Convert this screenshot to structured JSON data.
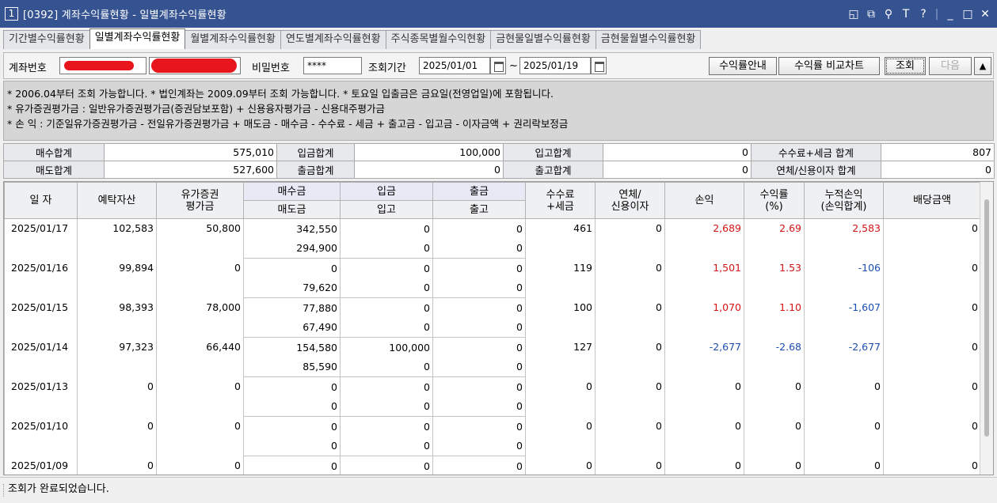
{
  "window": {
    "number": "1",
    "title": "[0392] 계좌수익률현황 - 일별계좌수익률현황",
    "controls": [
      "◱",
      "⧉",
      "⚲",
      "T",
      "?",
      "|",
      "_",
      "□",
      "✕"
    ]
  },
  "tabs": [
    "기간별수익률현황",
    "일별계좌수익률현황",
    "월별계좌수익률현황",
    "연도별계좌수익률현황",
    "주식종목별월수익현황",
    "금현물일별수익률현황",
    "금현물월별수익률현황"
  ],
  "toolbar": {
    "account_label": "계좌번호",
    "password_label": "비밀번호",
    "password_value": "****",
    "period_label": "조회기간",
    "date_from": "2025/01/01",
    "tilde": "~",
    "date_to": "2025/01/19",
    "btn_guide": "수익률안내",
    "btn_compare": "수익률 비교차트",
    "btn_search": "조회",
    "btn_next": "다음",
    "btn_collapse": "▲"
  },
  "notices": [
    "* 2006.04부터 조회 가능합니다.   * 법인계좌는 2009.09부터 조회 가능합니다.   * 토요일 입출금은 금요일(전영업일)에 포함됩니다.",
    "* 유가증권평가금 : 일반유가증권평가금(증권담보포함) + 신용융자평가금 - 신용대주평가금",
    "* 손          익 : 기준일유가증권평가금 - 전일유가증권평가금 + 매도금 - 매수금 - 수수료 - 세금 + 출고금 - 입고금 - 이자금액 + 권리락보정금"
  ],
  "summary": [
    [
      {
        "label": "매수합계",
        "value": "575,010"
      },
      {
        "label": "입금합계",
        "value": "100,000"
      },
      {
        "label": "입고합계",
        "value": "0"
      },
      {
        "label": "수수료+세금 합계",
        "value": "807"
      }
    ],
    [
      {
        "label": "매도합계",
        "value": "527,600"
      },
      {
        "label": "출금합계",
        "value": "0"
      },
      {
        "label": "출고합계",
        "value": "0"
      },
      {
        "label": "연체/신용이자 합계",
        "value": "0"
      }
    ]
  ],
  "grid": {
    "headers": {
      "date": "일 자",
      "deposit": "예탁자산",
      "securities": "유가증권\n평가금",
      "buy": "매수금",
      "sell": "매도금",
      "in_cash": "입금",
      "in_stock": "입고",
      "out_cash": "출금",
      "out_stock": "출고",
      "fee": "수수료\n+세금",
      "overdue": "연체/\n신용이자",
      "pnl": "손익",
      "rate": "수익률\n(%)",
      "cum": "누적손익\n(손익합계)",
      "dividend": "배당금액"
    },
    "rows": [
      {
        "date": "2025/01/17",
        "deposit": "102,583",
        "securities": "50,800",
        "buy": "342,550",
        "sell": "294,900",
        "in_cash": "0",
        "in_stock": "0",
        "out_cash": "0",
        "out_stock": "0",
        "fee": "461",
        "overdue": "0",
        "pnl": "2,689",
        "rate": "2.69",
        "cum": "2,583",
        "dividend": "0",
        "pnl_color": "red",
        "rate_color": "red",
        "cum_color": "red"
      },
      {
        "date": "2025/01/16",
        "deposit": "99,894",
        "securities": "0",
        "buy": "0",
        "sell": "79,620",
        "in_cash": "0",
        "in_stock": "0",
        "out_cash": "0",
        "out_stock": "0",
        "fee": "119",
        "overdue": "0",
        "pnl": "1,501",
        "rate": "1.53",
        "cum": "-106",
        "dividend": "0",
        "pnl_color": "red",
        "rate_color": "red",
        "cum_color": "blue"
      },
      {
        "date": "2025/01/15",
        "deposit": "98,393",
        "securities": "78,000",
        "buy": "77,880",
        "sell": "67,490",
        "in_cash": "0",
        "in_stock": "0",
        "out_cash": "0",
        "out_stock": "0",
        "fee": "100",
        "overdue": "0",
        "pnl": "1,070",
        "rate": "1.10",
        "cum": "-1,607",
        "dividend": "0",
        "pnl_color": "red",
        "rate_color": "red",
        "cum_color": "blue"
      },
      {
        "date": "2025/01/14",
        "deposit": "97,323",
        "securities": "66,440",
        "buy": "154,580",
        "sell": "85,590",
        "in_cash": "100,000",
        "in_stock": "0",
        "out_cash": "0",
        "out_stock": "0",
        "fee": "127",
        "overdue": "0",
        "pnl": "-2,677",
        "rate": "-2.68",
        "cum": "-2,677",
        "dividend": "0",
        "pnl_color": "blue",
        "rate_color": "blue",
        "cum_color": "blue"
      },
      {
        "date": "2025/01/13",
        "deposit": "0",
        "securities": "0",
        "buy": "0",
        "sell": "0",
        "in_cash": "0",
        "in_stock": "0",
        "out_cash": "0",
        "out_stock": "0",
        "fee": "0",
        "overdue": "0",
        "pnl": "0",
        "rate": "0",
        "cum": "0",
        "dividend": "0",
        "pnl_color": "",
        "rate_color": "",
        "cum_color": ""
      },
      {
        "date": "2025/01/10",
        "deposit": "0",
        "securities": "0",
        "buy": "0",
        "sell": "0",
        "in_cash": "0",
        "in_stock": "0",
        "out_cash": "0",
        "out_stock": "0",
        "fee": "0",
        "overdue": "0",
        "pnl": "0",
        "rate": "0",
        "cum": "0",
        "dividend": "0",
        "pnl_color": "",
        "rate_color": "",
        "cum_color": ""
      },
      {
        "date": "2025/01/09",
        "deposit": "0",
        "securities": "0",
        "buy": "0",
        "sell": "",
        "in_cash": "0",
        "in_stock": "",
        "out_cash": "0",
        "out_stock": "",
        "fee": "0",
        "overdue": "0",
        "pnl": "0",
        "rate": "0",
        "cum": "0",
        "dividend": "0",
        "pnl_color": "",
        "rate_color": "",
        "cum_color": ""
      }
    ]
  },
  "status": "조회가 완료되었습니다.",
  "colors": {
    "titlebar": "#365391",
    "profit": "#d21414",
    "loss": "#1a4fb2",
    "redaction": "#e8151c"
  }
}
